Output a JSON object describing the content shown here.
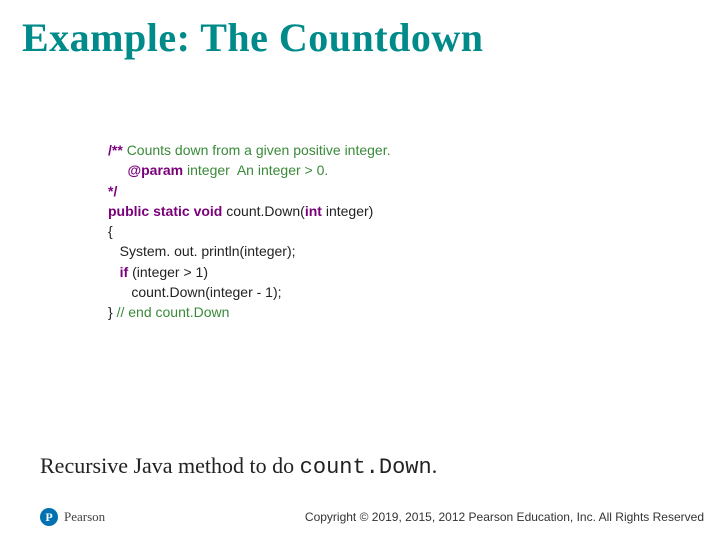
{
  "title": "Example: The Countdown",
  "code": {
    "l1a": "/** ",
    "l1b": "Counts down from a given positive integer.",
    "l2a": "     ",
    "l2b": "@param",
    "l2c": " integer  An integer > 0.",
    "l3": "*/",
    "l4a": "public static void ",
    "l4b": "count.Down(",
    "l4c": "int ",
    "l4d": "integer)",
    "l5": "{",
    "l6": "   System. out. println(integer);",
    "l7a": "   ",
    "l7b": "if ",
    "l7c": "(integer > 1)",
    "l8": "      count.Down(integer - 1);",
    "l9a": "} ",
    "l9b": "// end count.Down"
  },
  "caption": {
    "prefix": "Recursive Java method to do ",
    "mono": "count.Down",
    "suffix": "."
  },
  "logo": {
    "mark": "P",
    "name": "Pearson"
  },
  "footer": "Copyright © 2019, 2015, 2012 Pearson Education, Inc. All Rights Reserved"
}
